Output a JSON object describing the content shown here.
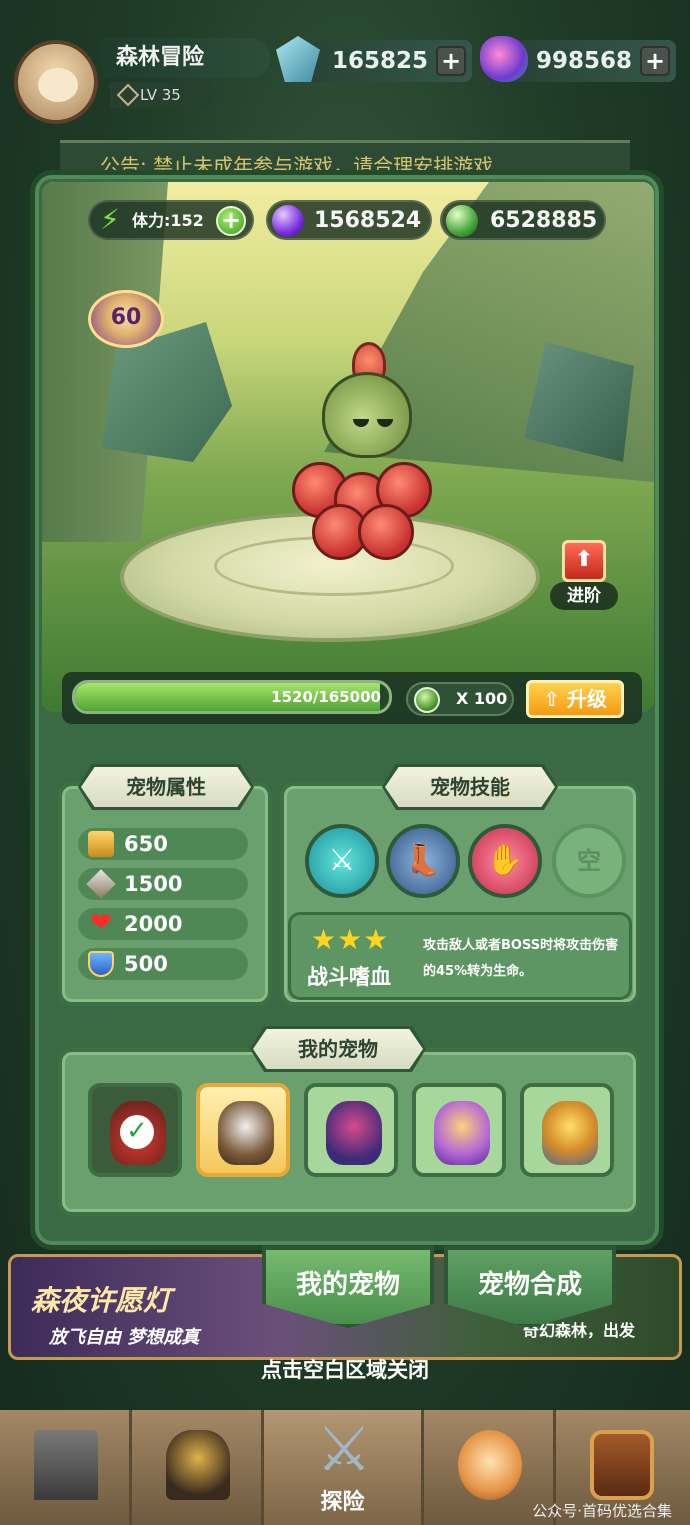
{
  "player": {
    "name": "森林冒险",
    "level": "LV 35",
    "crystal": "165825",
    "gem": "998568"
  },
  "notice": "公告: 禁止未成年参与游戏，请合理安排游戏",
  "resources": {
    "stamina": "体力:152",
    "purple_orb": "1568524",
    "green_orb": "6528885"
  },
  "pet": {
    "level": "60",
    "advance_label": "进阶",
    "exp_text": "1520/165000",
    "exp_fraction": 0.0092,
    "upgrade_cost": "X 100",
    "upgrade_label": "升级"
  },
  "attributes": {
    "title": "宠物属性",
    "rows": [
      {
        "icon": "boots-icon",
        "value": "650"
      },
      {
        "icon": "sword-icon",
        "value": "1500"
      },
      {
        "icon": "heart-icon",
        "value": "2000"
      },
      {
        "icon": "shield-icon",
        "value": "500"
      }
    ]
  },
  "skills": {
    "title": "宠物技能",
    "slots": [
      {
        "icon": "blade-skill-icon",
        "color": "#3fd0cf"
      },
      {
        "icon": "boot-skill-icon",
        "color": "#4d7aa6"
      },
      {
        "icon": "claw-skill-icon",
        "color": "#e0445a"
      },
      {
        "icon": "empty-slot-icon",
        "label": "空"
      }
    ],
    "selected": {
      "stars": "★★★",
      "name": "战斗嗜血",
      "description": "攻击敌人或者BOSS时将攻击伤害的45%转为生命。"
    }
  },
  "my_pets": {
    "title": "我的宠物",
    "cards": [
      {
        "name": "flower-pet",
        "selected": true
      },
      {
        "name": "beast-pet",
        "highlight": true
      },
      {
        "name": "bat-pet"
      },
      {
        "name": "fairy-pet"
      },
      {
        "name": "robot-pet"
      }
    ]
  },
  "tabs": {
    "my_pets": "我的宠物",
    "merge": "宠物合成"
  },
  "event": {
    "title": "森夜许愿灯",
    "subtitle": "放飞自由 梦想成真",
    "sub_right": "奇幻森林，出发"
  },
  "close_hint": "点击空白区域关闭",
  "bottom_nav": [
    {
      "icon": "tower-icon",
      "label": ""
    },
    {
      "icon": "helmet-icon",
      "label": ""
    },
    {
      "icon": "crossed-swords-icon",
      "label": "探险"
    },
    {
      "icon": "fox-icon",
      "label": ""
    },
    {
      "icon": "chest-icon",
      "label": ""
    }
  ],
  "watermark": "公众号·首码优选合集",
  "colors": {
    "panel_green": "#3a6a43",
    "gold": "#f5a216",
    "advance_red": "#d3362a"
  }
}
